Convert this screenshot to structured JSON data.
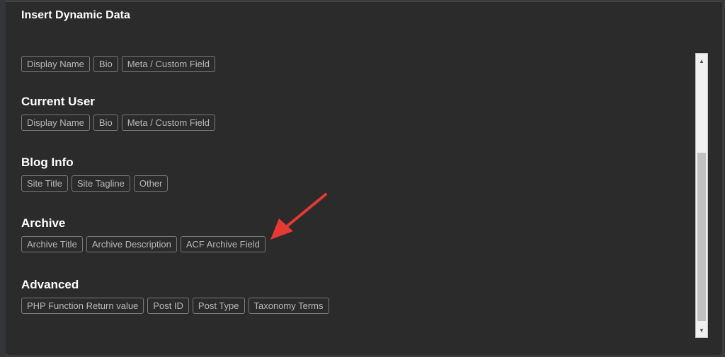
{
  "dialog": {
    "title": "Insert Dynamic Data"
  },
  "sections": [
    {
      "heading": "",
      "tags": [
        "Display Name",
        "Bio",
        "Meta / Custom Field"
      ]
    },
    {
      "heading": "Current User",
      "tags": [
        "Display Name",
        "Bio",
        "Meta / Custom Field"
      ]
    },
    {
      "heading": "Blog Info",
      "tags": [
        "Site Title",
        "Site Tagline",
        "Other"
      ]
    },
    {
      "heading": "Archive",
      "tags": [
        "Archive Title",
        "Archive Description",
        "ACF Archive Field"
      ]
    },
    {
      "heading": "Advanced",
      "tags": [
        "PHP Function Return value",
        "Post ID",
        "Post Type",
        "Taxonomy Terms"
      ]
    }
  ],
  "scrollbar": {
    "up_icon": "triangle-up",
    "down_icon": "triangle-down",
    "scroll_position_fraction": 0.35
  },
  "annotation": {
    "icon": "red-arrow",
    "color": "#e53935",
    "points_to": "ACF Archive Field"
  },
  "colors": {
    "background": "#2b2b2b",
    "heading": "#ffffff",
    "tag_text": "#b8b8b8",
    "tag_border": "#7a7a7a"
  }
}
